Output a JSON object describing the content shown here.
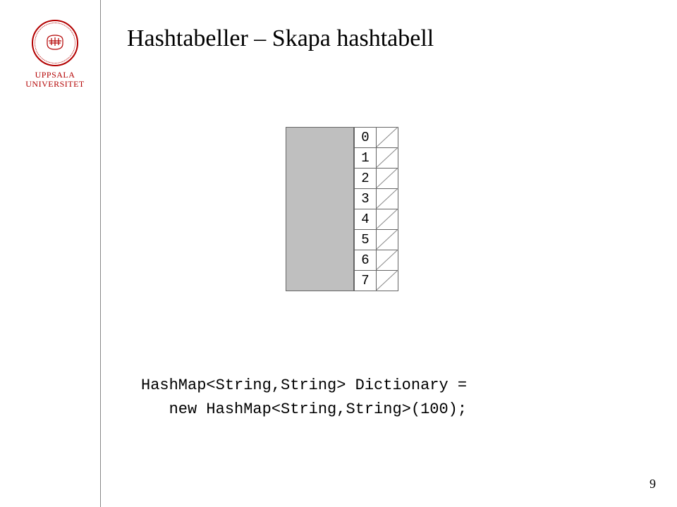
{
  "logo": {
    "line1": "UPPSALA",
    "line2": "UNIVERSITET"
  },
  "title": "Hashtabeller – Skapa hashtabell",
  "buckets": [
    "0",
    "1",
    "2",
    "3",
    "4",
    "5",
    "6",
    "7"
  ],
  "code": {
    "line1": "HashMap<String,String> Dictionary =",
    "line2": "   new HashMap<String,String>(100);"
  },
  "page_number": "9"
}
